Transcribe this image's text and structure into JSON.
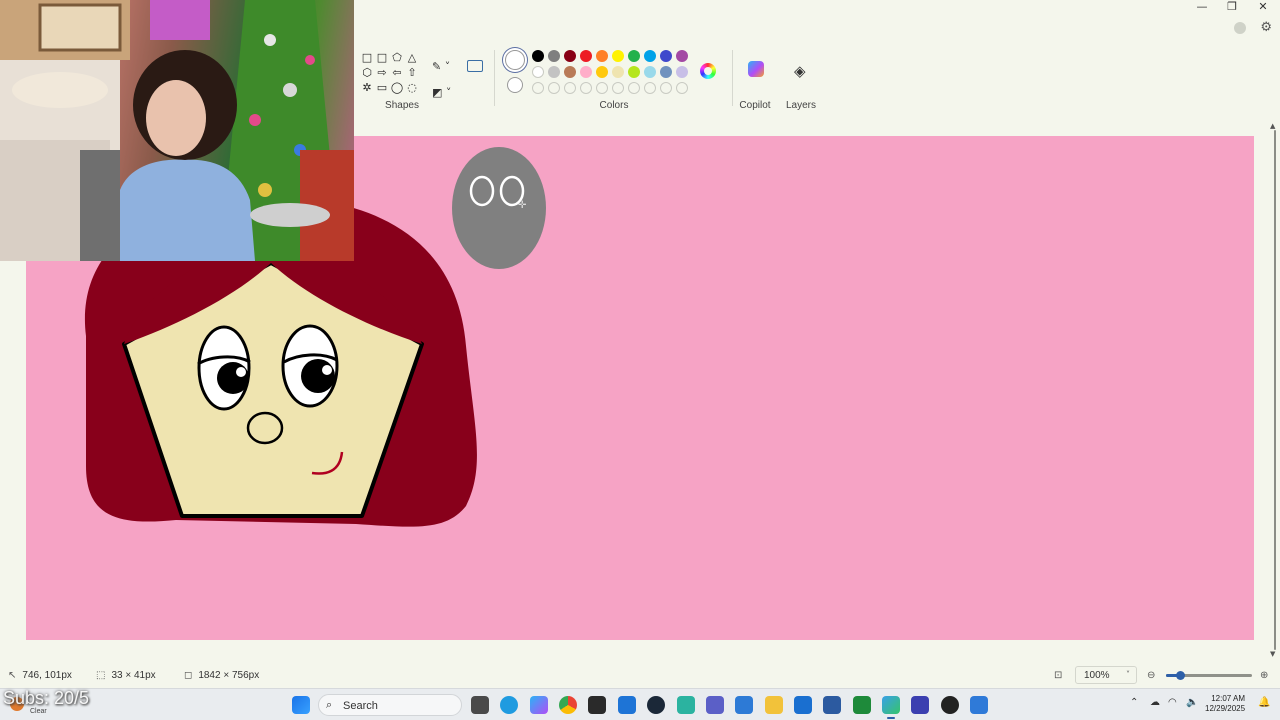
{
  "window": {
    "minimize": "—",
    "restore": "❐",
    "close": "✕",
    "settings_icon": "gear-icon"
  },
  "ribbon": {
    "shapes_label": "Shapes",
    "colors_label": "Colors",
    "copilot_label": "Copilot",
    "layers_label": "Layers",
    "shape_glyphs": [
      "□",
      "□",
      "⬠",
      "△",
      "⬡",
      "⇨",
      "⇦",
      "⇧",
      "✲",
      "▭",
      "◯",
      "◌"
    ],
    "swatch_row1": [
      "#000000",
      "#7f7f7f",
      "#880015",
      "#ed1c24",
      "#ff7f27",
      "#fff200",
      "#22b14c",
      "#00a2e8",
      "#3f48cc",
      "#a349a4"
    ],
    "swatch_row2": [
      "#ffffff",
      "#c3c3c3",
      "#b97a57",
      "#ffaec9",
      "#ffc90e",
      "#efe4b0",
      "#b5e61d",
      "#99d9ea",
      "#7092be",
      "#c8bfe7"
    ],
    "swatch_row3_count": 10
  },
  "canvas": {
    "background": "#f6a3c5"
  },
  "status": {
    "cursor_pos": "746, 101px",
    "selection_size": "33 × 41px",
    "canvas_size": "1842 × 756px",
    "zoom": "100%",
    "zoom_level": 0.16
  },
  "overlay": {
    "subs": "Subs: 20/5"
  },
  "taskbar": {
    "search_label": "Search",
    "weather_text": "Clear",
    "time": "12:07 AM",
    "date": "12/29/2025"
  }
}
